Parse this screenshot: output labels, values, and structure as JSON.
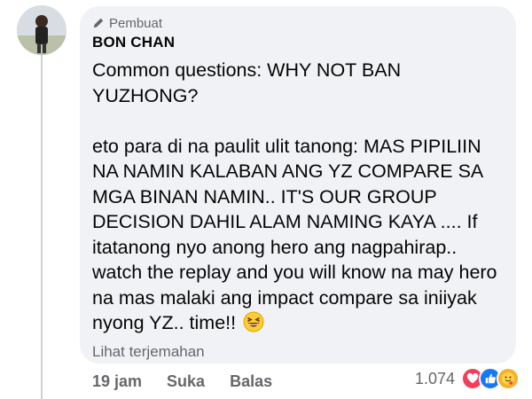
{
  "comment": {
    "badge": "Pembuat",
    "author": "BON CHAN",
    "line1": "Common questions: WHY NOT BAN YUZHONG?",
    "line2": "eto para di na paulit ulit tanong: MAS PIPILIIN NA NAMIN KALABAN ANG YZ COMPARE SA MGA BINAN NAMIN.. IT'S OUR GROUP DECISION DAHIL ALAM NAMING KAYA .... If itatanong nyo anong hero ang nagpahirap.. watch the replay and you will know na may hero na mas malaki ang impact compare sa iniiyak nyong YZ.. time!!",
    "emoji": "grinning-squinting-face",
    "translate_link": "Lihat terjemahan"
  },
  "actions": {
    "time": "19 jam",
    "like": "Suka",
    "reply": "Balas"
  },
  "reactions": {
    "count": "1.074",
    "icons": [
      "love-reaction-icon",
      "like-reaction-icon",
      "care-reaction-icon"
    ]
  },
  "colors": {
    "bubble": "#f0f2f5",
    "secondary_text": "#65676b",
    "like_blue": "#1877f2",
    "love_red": "#f33e58",
    "care_yellow": "#f7b125"
  }
}
